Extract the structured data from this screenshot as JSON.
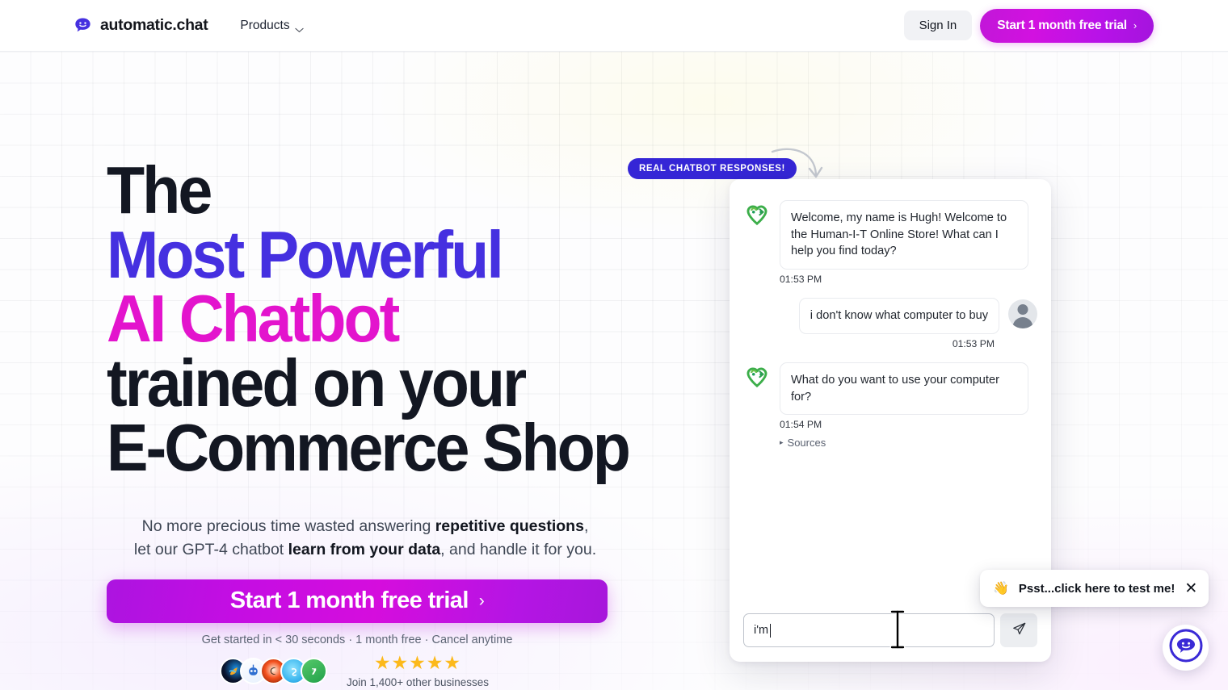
{
  "header": {
    "brand_name": "automatic.chat",
    "brand_icon": "chat-smiley-logo-icon",
    "nav": {
      "products_label": "Products",
      "chevron_icon": "chevron-down-icon"
    },
    "sign_in_label": "Sign In",
    "trial_label": "Start 1 month free trial",
    "trial_arrow": "›"
  },
  "hero": {
    "headline_lines": [
      {
        "text": "The",
        "color": "#131722"
      },
      {
        "text": "Most Powerful",
        "color": "#4530e0"
      },
      {
        "text": "AI Chatbot",
        "color": "#e314cd"
      },
      {
        "text": "trained on your",
        "color": "#131722"
      },
      {
        "text": "E-Commerce Shop",
        "color": "#131722"
      }
    ],
    "sub_line1_pre": "No more precious time wasted answering ",
    "sub_line1_bold": "repetitive questions",
    "sub_line1_post": ",",
    "sub_line2_pre": "let our GPT-4 chatbot ",
    "sub_line2_bold": "learn from your data",
    "sub_line2_post": ", and handle it for you.",
    "cta_label": "Start 1 month free trial",
    "cta_arrow": "›",
    "cta_note": "Get started in < 30 seconds · 1 month free · Cancel anytime"
  },
  "social_proof": {
    "stars": "★★★★★",
    "star_count": 5,
    "join_text": "Join 1,400+ other businesses",
    "avatars": [
      {
        "name": "customer-avatar-1",
        "color": "#0b1020"
      },
      {
        "name": "customer-avatar-2",
        "color": "#2f6fd0"
      },
      {
        "name": "customer-avatar-3",
        "color": "#f4511e"
      },
      {
        "name": "customer-avatar-4",
        "color": "#3fb8ef"
      },
      {
        "name": "customer-avatar-5",
        "color": "#2bb24c"
      }
    ]
  },
  "callout": {
    "badge_text": "REAL CHATBOT RESPONSES!",
    "badge_color": "#3526d6",
    "arrow_icon": "curved-arrow-icon"
  },
  "chat_widget": {
    "bot_avatar_icon": "human-i-t-logo-icon",
    "user_avatar_icon": "user-avatar-icon",
    "messages": [
      {
        "sender": "bot",
        "text": "Welcome, my name is Hugh! Welcome to the Human-I-T Online Store! What can I help you find today?",
        "time": "01:53 PM"
      },
      {
        "sender": "user",
        "text": "i don't know what computer to buy",
        "time": "01:53 PM"
      },
      {
        "sender": "bot",
        "text": "What do you want to use your computer for?",
        "time": "01:54 PM",
        "sources_label": "Sources",
        "sources_triangle": "▸"
      }
    ],
    "input_value": "i'm ",
    "input_placeholder": "",
    "send_icon": "paper-plane-send-icon"
  },
  "toast": {
    "emoji": "👋",
    "text": "Psst...click here to test me!",
    "close_icon": "close-icon",
    "close_glyph": "✕"
  },
  "launcher": {
    "icon": "chat-bubble-smiley-launcher-icon",
    "color": "#3a2ad6"
  },
  "cursor": {
    "type": "i-beam-text-cursor"
  }
}
